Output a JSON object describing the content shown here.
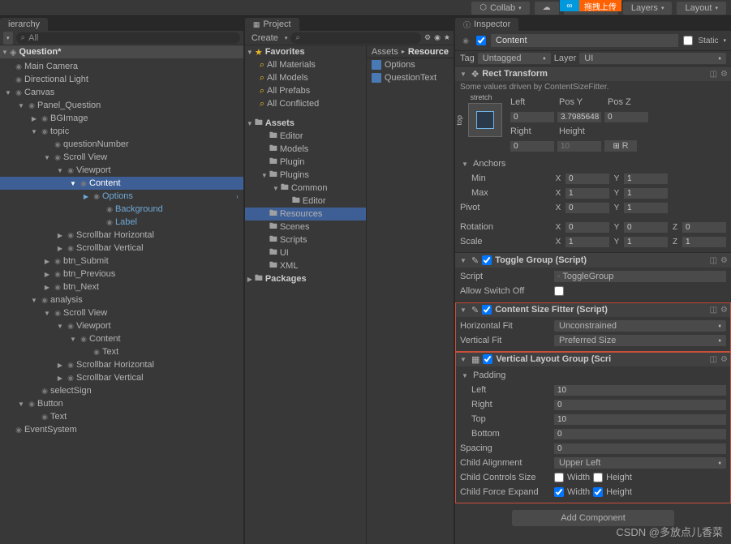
{
  "upload_badge": {
    "icon": "∞",
    "text": "拖拽上传"
  },
  "toolbar": {
    "collab": "Collab",
    "account": "Account",
    "layers": "Layers",
    "layout": "Layout"
  },
  "hierarchy": {
    "tab": "ierarchy",
    "scene": "Question*",
    "tree": [
      {
        "d": 0,
        "f": "",
        "n": "Main Camera"
      },
      {
        "d": 0,
        "f": "",
        "n": "Directional Light"
      },
      {
        "d": 0,
        "f": "▼",
        "n": "Canvas"
      },
      {
        "d": 1,
        "f": "▼",
        "n": "Panel_Question"
      },
      {
        "d": 2,
        "f": "▶",
        "n": "BGImage"
      },
      {
        "d": 2,
        "f": "▼",
        "n": "topic"
      },
      {
        "d": 3,
        "f": "",
        "n": "questionNumber"
      },
      {
        "d": 3,
        "f": "▼",
        "n": "Scroll View"
      },
      {
        "d": 4,
        "f": "▼",
        "n": "Viewport"
      },
      {
        "d": 5,
        "f": "▼",
        "n": "Content",
        "sel": true
      },
      {
        "d": 6,
        "f": "▶",
        "n": "Options",
        "sub": true,
        "arrow": true
      },
      {
        "d": 7,
        "f": "",
        "n": "Background",
        "sub": true
      },
      {
        "d": 7,
        "f": "",
        "n": "Label",
        "sub": true
      },
      {
        "d": 4,
        "f": "▶",
        "n": "Scrollbar Horizontal"
      },
      {
        "d": 4,
        "f": "▶",
        "n": "Scrollbar Vertical"
      },
      {
        "d": 3,
        "f": "▶",
        "n": "btn_Submit"
      },
      {
        "d": 3,
        "f": "▶",
        "n": "btn_Previous"
      },
      {
        "d": 3,
        "f": "▶",
        "n": "btn_Next"
      },
      {
        "d": 2,
        "f": "▼",
        "n": "analysis"
      },
      {
        "d": 3,
        "f": "▼",
        "n": "Scroll View"
      },
      {
        "d": 4,
        "f": "▼",
        "n": "Viewport"
      },
      {
        "d": 5,
        "f": "▼",
        "n": "Content"
      },
      {
        "d": 6,
        "f": "",
        "n": "Text"
      },
      {
        "d": 4,
        "f": "▶",
        "n": "Scrollbar Horizontal"
      },
      {
        "d": 4,
        "f": "▶",
        "n": "Scrollbar Vertical"
      },
      {
        "d": 2,
        "f": "",
        "n": "selectSign"
      },
      {
        "d": 1,
        "f": "▼",
        "n": "Button"
      },
      {
        "d": 2,
        "f": "",
        "n": "Text"
      },
      {
        "d": 0,
        "f": "",
        "n": "EventSystem"
      }
    ]
  },
  "project": {
    "tab": "Project",
    "create": "Create",
    "favorites": "Favorites",
    "fav_items": [
      "All Materials",
      "All Models",
      "All Prefabs",
      "All Conflicted"
    ],
    "assets": "Assets",
    "folders": [
      {
        "d": 1,
        "f": "",
        "n": "Editor"
      },
      {
        "d": 1,
        "f": "",
        "n": "Models"
      },
      {
        "d": 1,
        "f": "",
        "n": "Plugin"
      },
      {
        "d": 1,
        "f": "▼",
        "n": "Plugins"
      },
      {
        "d": 2,
        "f": "▼",
        "n": "Common"
      },
      {
        "d": 3,
        "f": "",
        "n": "Editor"
      },
      {
        "d": 1,
        "f": "",
        "n": "Resources",
        "sel": true
      },
      {
        "d": 1,
        "f": "",
        "n": "Scenes"
      },
      {
        "d": 1,
        "f": "",
        "n": "Scripts"
      },
      {
        "d": 1,
        "f": "",
        "n": "UI"
      },
      {
        "d": 1,
        "f": "",
        "n": "XML"
      }
    ],
    "packages": "Packages",
    "breadcrumb": [
      "Assets",
      "Resource"
    ],
    "right_items": [
      "Options",
      "QuestionText"
    ]
  },
  "inspector": {
    "tab": "Inspector",
    "name": "Content",
    "static": "Static",
    "tag_lbl": "Tag",
    "tag_val": "Untagged",
    "layer_lbl": "Layer",
    "layer_val": "UI",
    "rect": {
      "title": "Rect Transform",
      "note": "Some values driven by ContentSizeFitter.",
      "stretch": "stretch",
      "top": "top",
      "left_lbl": "Left",
      "left": "0",
      "posy_lbl": "Pos Y",
      "posy": "3.7985648",
      "posz_lbl": "Pos Z",
      "posz": "0",
      "right_lbl": "Right",
      "right": "0",
      "height_lbl": "Height",
      "height": "10",
      "r_btn": "R",
      "anchors": "Anchors",
      "min": "Min",
      "min_x": "0",
      "min_y": "1",
      "max": "Max",
      "max_x": "1",
      "max_y": "1",
      "pivot": "Pivot",
      "piv_x": "0",
      "piv_y": "1",
      "rot": "Rotation",
      "rot_x": "0",
      "rot_y": "0",
      "rot_z": "0",
      "scale": "Scale",
      "scl_x": "1",
      "scl_y": "1",
      "scl_z": "1"
    },
    "toggle_group": {
      "title": "Toggle Group (Script)",
      "script_lbl": "Script",
      "script_val": "ToggleGroup",
      "allow": "Allow Switch Off"
    },
    "csf": {
      "title": "Content Size Fitter (Script)",
      "hfit_lbl": "Horizontal Fit",
      "hfit": "Unconstrained",
      "vfit_lbl": "Vertical Fit",
      "vfit": "Preferred Size"
    },
    "vlg": {
      "title": "Vertical Layout Group (Scri",
      "padding": "Padding",
      "left_lbl": "Left",
      "left": "10",
      "right_lbl": "Right",
      "right": "0",
      "top_lbl": "Top",
      "top": "10",
      "bottom_lbl": "Bottom",
      "bottom": "0",
      "spacing_lbl": "Spacing",
      "spacing": "0",
      "align_lbl": "Child Alignment",
      "align": "Upper Left",
      "ctrl_lbl": "Child Controls Size",
      "expand_lbl": "Child Force Expand",
      "width": "Width",
      "height": "Height"
    },
    "add_comp": "Add Component"
  },
  "watermark": "CSDN @多放点儿香菜"
}
